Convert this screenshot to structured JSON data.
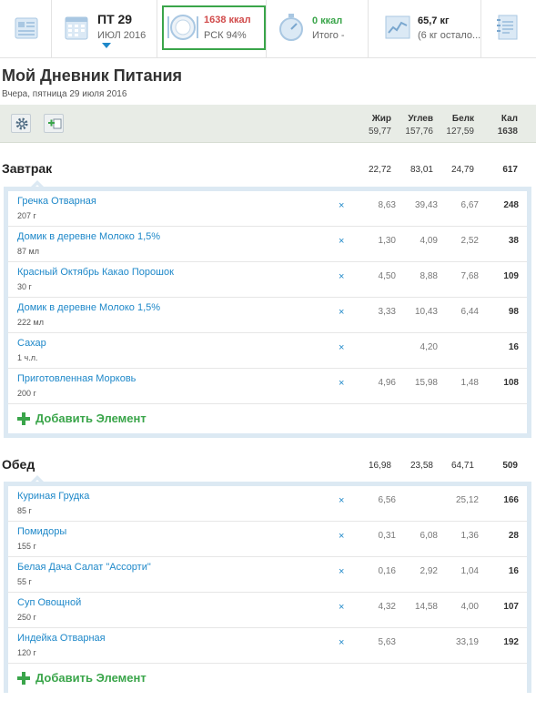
{
  "topbar": {
    "day": "ПТ 29",
    "month": "ИЮЛ 2016",
    "kcal": "1638 ккал",
    "rsk": "РСК 94%",
    "burn_kcal": "0 ккал",
    "total": "Итого -",
    "weight": "65,7 кг",
    "weight_left": "(6 кг остало...",
    "colors": {
      "accent": "#1e88c9",
      "green": "#3aa54a",
      "red": "#d14b4b"
    }
  },
  "header": {
    "title": "Мой Дневник Питания",
    "subtitle": "Вчера, пятница 29 июля 2016"
  },
  "columns": {
    "fat": "Жир",
    "carb": "Углев",
    "prot": "Белк",
    "kal": "Кал",
    "totals": {
      "fat": "59,77",
      "carb": "157,76",
      "prot": "127,59",
      "kal": "1638"
    }
  },
  "meals": [
    {
      "name": "Завтрак",
      "totals": {
        "fat": "22,72",
        "carb": "83,01",
        "prot": "24,79",
        "kal": "617"
      },
      "items": [
        {
          "name": "Гречка Отварная",
          "qty": "207 г",
          "fat": "8,63",
          "carb": "39,43",
          "prot": "6,67",
          "kal": "248"
        },
        {
          "name": "Домик в деревне Молоко 1,5%",
          "qty": "87 мл",
          "fat": "1,30",
          "carb": "4,09",
          "prot": "2,52",
          "kal": "38"
        },
        {
          "name": "Красный Октябрь Какао Порошок",
          "qty": "30 г",
          "fat": "4,50",
          "carb": "8,88",
          "prot": "7,68",
          "kal": "109"
        },
        {
          "name": "Домик в деревне Молоко 1,5%",
          "qty": "222 мл",
          "fat": "3,33",
          "carb": "10,43",
          "prot": "6,44",
          "kal": "98"
        },
        {
          "name": "Сахар",
          "qty": "1 ч.л.",
          "fat": "",
          "carb": "4,20",
          "prot": "",
          "kal": "16"
        },
        {
          "name": "Приготовленная Морковь",
          "qty": "200 г",
          "fat": "4,96",
          "carb": "15,98",
          "prot": "1,48",
          "kal": "108"
        }
      ],
      "add_label": "Добавить Элемент"
    },
    {
      "name": "Обед",
      "totals": {
        "fat": "16,98",
        "carb": "23,58",
        "prot": "64,71",
        "kal": "509"
      },
      "items": [
        {
          "name": "Куриная Грудка",
          "qty": "85 г",
          "fat": "6,56",
          "carb": "",
          "prot": "25,12",
          "kal": "166"
        },
        {
          "name": "Помидоры",
          "qty": "155 г",
          "fat": "0,31",
          "carb": "6,08",
          "prot": "1,36",
          "kal": "28"
        },
        {
          "name": "Белая Дача Салат \"Ассорти\"",
          "qty": "55 г",
          "fat": "0,16",
          "carb": "2,92",
          "prot": "1,04",
          "kal": "16"
        },
        {
          "name": "Суп Овощной",
          "qty": "250 г",
          "fat": "4,32",
          "carb": "14,58",
          "prot": "4,00",
          "kal": "107"
        },
        {
          "name": "Индейка Отварная",
          "qty": "120 г",
          "fat": "5,63",
          "carb": "",
          "prot": "33,19",
          "kal": "192"
        }
      ],
      "add_label": "Добавить Элемент"
    }
  ],
  "delete_glyph": "×"
}
